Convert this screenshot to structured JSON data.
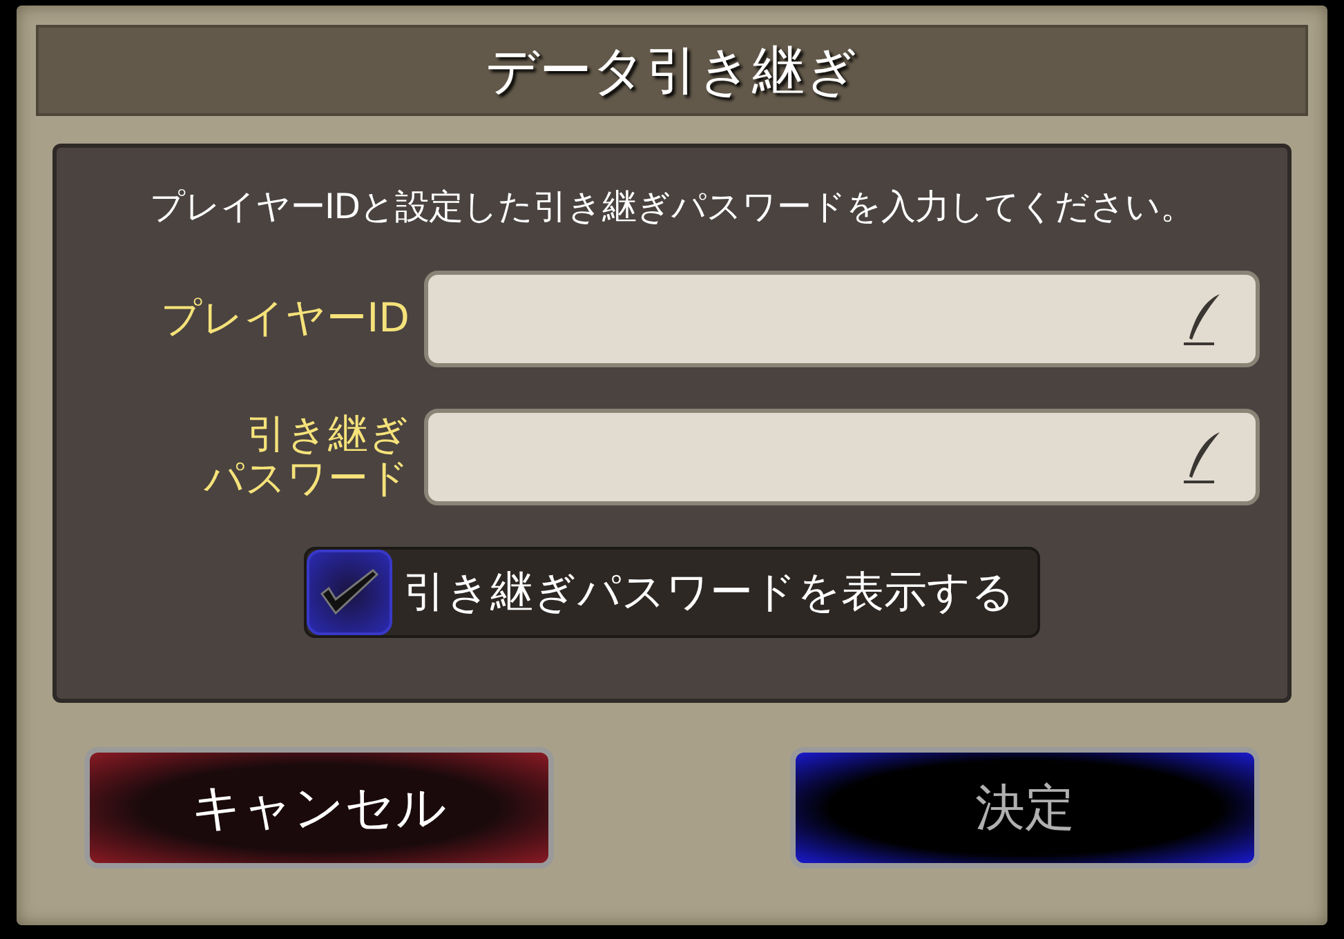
{
  "dialog": {
    "title": "データ引き継ぎ",
    "instruction": "プレイヤーIDと設定した引き継ぎパスワードを入力してください。",
    "fields": [
      {
        "label_lines": [
          "プレイヤーID"
        ]
      },
      {
        "label_lines": [
          "引き継ぎ",
          "パスワード"
        ]
      }
    ],
    "show_password": {
      "label": "引き継ぎパスワードを表示する",
      "checked": true
    },
    "buttons": [
      {
        "label": "キャンセル",
        "kind": "cancel",
        "disabled": false
      },
      {
        "label": "決定",
        "kind": "confirm",
        "disabled": true
      }
    ]
  }
}
